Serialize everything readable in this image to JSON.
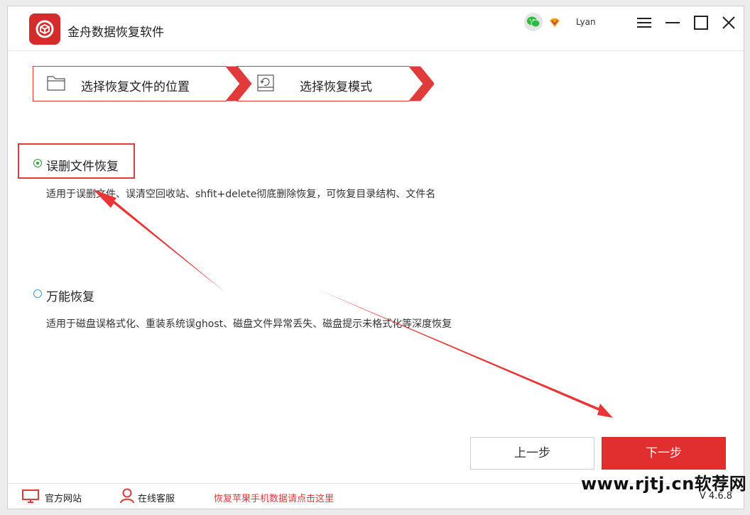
{
  "app": {
    "title": "金舟数据恢复软件",
    "username": "Lyan",
    "accent_color": "#e12e2e"
  },
  "steps": [
    {
      "label": "选择恢复文件的位置",
      "icon": "folder-icon"
    },
    {
      "label": "选择恢复模式",
      "icon": "restore-disk-icon"
    }
  ],
  "options": [
    {
      "label": "误删文件恢复",
      "description": "适用于误删文件、误清空回收站、shfit+delete彻底删除恢复，可恢复目录结构、文件名",
      "selected": true
    },
    {
      "label": "万能恢复",
      "description": "适用于磁盘误格式化、重装系统误ghost、磁盘文件异常丢失、磁盘提示未格式化等深度恢复",
      "selected": false
    }
  ],
  "buttons": {
    "prev": "上一步",
    "next": "下一步"
  },
  "footer": {
    "official_site": "官方网站",
    "online_service": "在线客服",
    "apple_recovery_link": "恢复苹果手机数据请点击这里",
    "version": "V 4.6.8"
  },
  "watermark": "www.rjtj.cn软荐网"
}
